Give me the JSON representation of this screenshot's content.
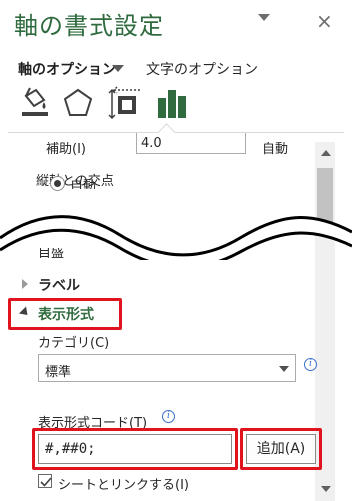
{
  "pane": {
    "title": "軸の書式設定",
    "menu_icon": "chevron-down-icon",
    "close_icon": "×"
  },
  "tabs": {
    "axis_options": "軸のオプション",
    "text_options": "文字のオプション"
  },
  "icon_tabs": [
    "fill-line-icon",
    "effects-pentagon-icon",
    "size-properties-icon",
    "axis-options-bar-icon"
  ],
  "colors": {
    "accent_green": "#2f6b3f",
    "highlight_red": "#e0141e"
  },
  "partial": {
    "aux_label": "補助(I)",
    "aux_value": "4.0",
    "auto_label": "自動",
    "cross_label": "縦軸との交点",
    "radio_label": "自動",
    "mid_label": "目盛"
  },
  "sections": {
    "label": "ラベル",
    "display_format": "表示形式"
  },
  "category": {
    "label": "カテゴリ(C)",
    "value": "標準"
  },
  "format_code": {
    "label": "表示形式コード(T)",
    "value": "#,##0;",
    "add_button": "追加(A)"
  },
  "link": {
    "label": "シートとリンクする(I)",
    "checked": true
  }
}
